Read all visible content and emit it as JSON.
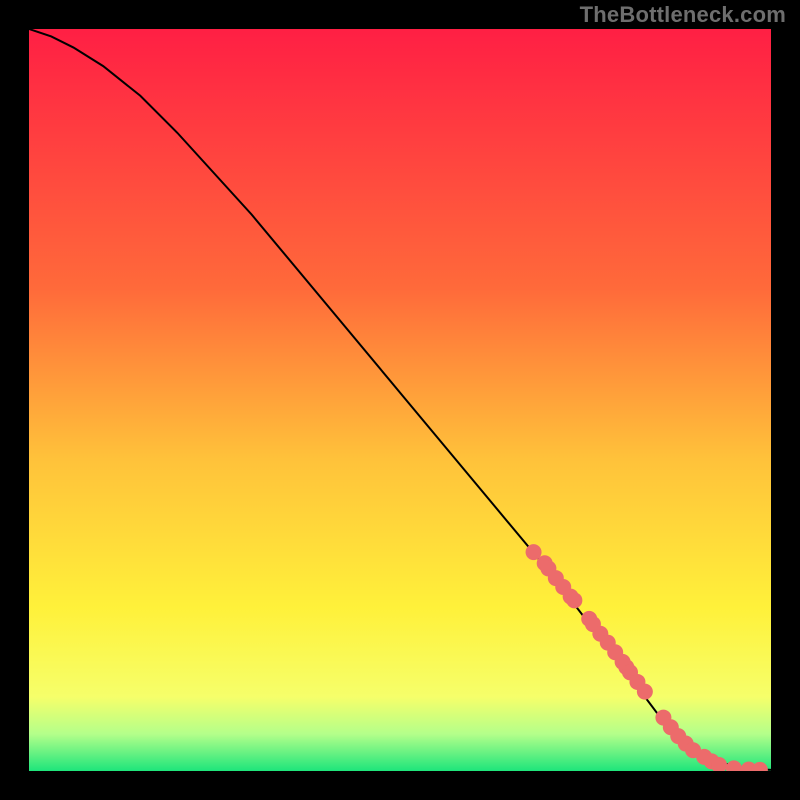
{
  "watermark": "TheBottleneck.com",
  "colors": {
    "gradient_top": "#ff1f44",
    "gradient_mid_upper": "#ff6a3a",
    "gradient_mid": "#ffc23a",
    "gradient_mid_lower": "#fff13a",
    "gradient_lower": "#f6ff6a",
    "gradient_bottom": "#1ee57b",
    "curve": "#000000",
    "marker": "#ec6b6b",
    "frame": "#000000"
  },
  "chart_data": {
    "type": "line",
    "title": "",
    "xlabel": "",
    "ylabel": "",
    "xlim": [
      0,
      100
    ],
    "ylim": [
      0,
      100
    ],
    "series": [
      {
        "name": "curve",
        "x": [
          0,
          3,
          6,
          10,
          15,
          20,
          30,
          40,
          50,
          60,
          70,
          80,
          86,
          90,
          93,
          95,
          97,
          99,
          100
        ],
        "y": [
          100,
          99,
          97.5,
          95,
          91,
          86,
          75,
          63,
          51,
          39,
          27,
          14,
          6,
          2.5,
          1.2,
          0.7,
          0.4,
          0.2,
          0.15
        ]
      }
    ],
    "markers": {
      "name": "highlighted-points",
      "x": [
        68,
        69.5,
        70,
        71,
        72,
        73,
        73.5,
        75.5,
        76,
        77,
        78,
        79,
        80,
        80.5,
        81,
        82,
        83,
        85.5,
        86.5,
        87.5,
        88.5,
        89.5,
        91,
        92,
        93,
        95,
        97,
        98.5
      ],
      "y": [
        29.5,
        28,
        27.3,
        26,
        24.8,
        23.5,
        23,
        20.5,
        19.8,
        18.5,
        17.3,
        16,
        14.7,
        14,
        13.3,
        12,
        10.7,
        7.2,
        5.9,
        4.7,
        3.7,
        2.8,
        1.9,
        1.3,
        0.8,
        0.35,
        0.2,
        0.15
      ]
    }
  }
}
